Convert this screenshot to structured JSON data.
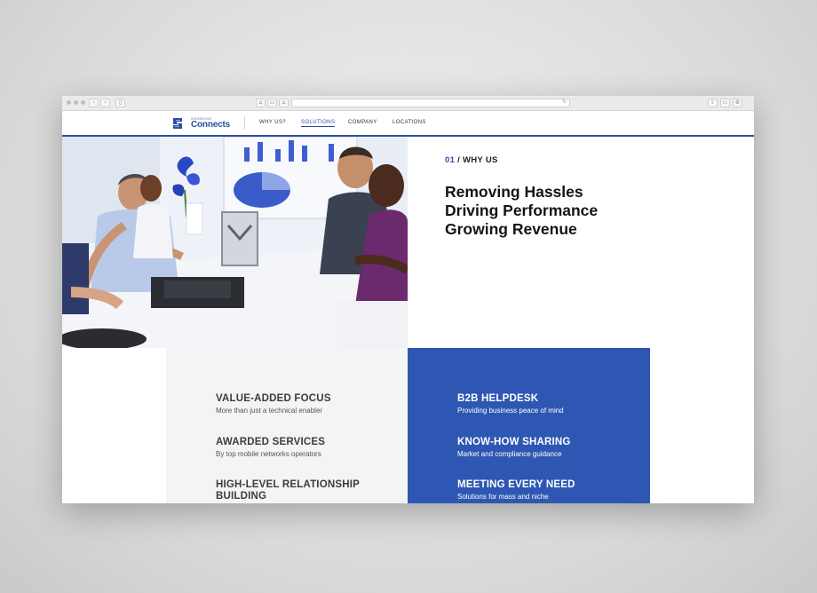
{
  "nav": {
    "logo_small": "SMSBONE",
    "logo_text": "Connects",
    "items": [
      {
        "label": "WHY US?"
      },
      {
        "label": "SOLUTIONS"
      },
      {
        "label": "COMPANY"
      },
      {
        "label": "LOCATIONS"
      }
    ],
    "active_index": 1
  },
  "hero": {
    "section_number": "01",
    "section_separator": " / ",
    "section_title": "WHY US",
    "headline_lines": [
      "Removing Hassles",
      "Driving Performance",
      "Growing Revenue"
    ]
  },
  "features_left": [
    {
      "title": "VALUE-ADDED FOCUS",
      "subtitle": "More than just a technical enabler"
    },
    {
      "title": "AWARDED SERVICES",
      "subtitle": "By top mobile networks operators"
    },
    {
      "title": "HIGH-LEVEL RELATIONSHIP BUILDING",
      "subtitle": ""
    }
  ],
  "features_right": [
    {
      "title": "B2B HELPDESK",
      "subtitle": "Providing business peace of mind"
    },
    {
      "title": "KNOW-HOW SHARING",
      "subtitle": "Market and compliance guidance"
    },
    {
      "title": "MEETING EVERY NEED",
      "subtitle": "Solutions for mass and niche"
    }
  ],
  "colors": {
    "brand_blue": "#2e57b3",
    "nav_accent": "#2b4fa3",
    "panel_gray": "#f4f4f4"
  },
  "icons": {
    "logo": "logo-icon",
    "back": "chevron-left-icon",
    "forward": "chevron-right-icon",
    "reload": "reload-icon"
  }
}
